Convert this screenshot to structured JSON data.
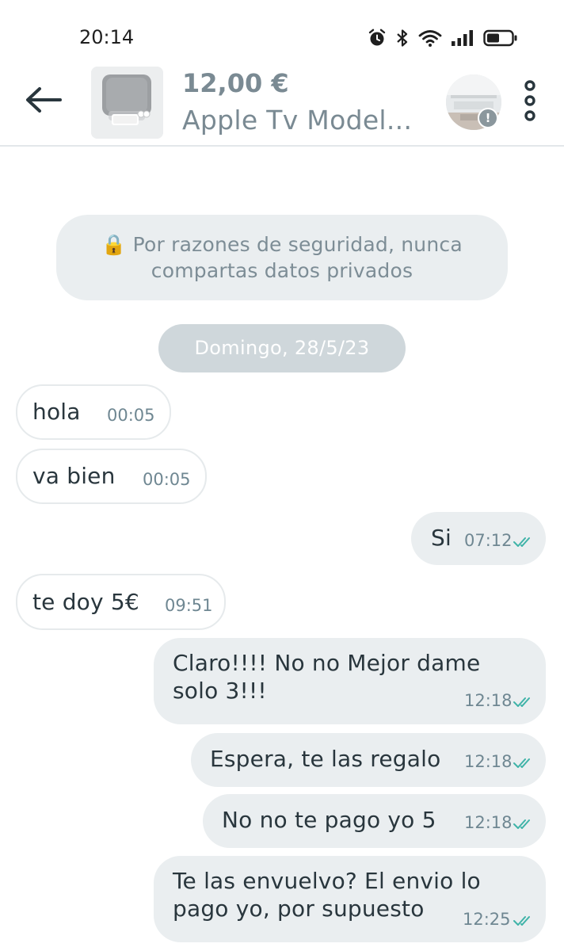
{
  "status_bar": {
    "time": "20:14",
    "icons": [
      "alarm-icon",
      "bluetooth-icon",
      "wifi-icon",
      "signal-icon",
      "battery-icon"
    ]
  },
  "header": {
    "back_icon": "arrow-left-icon",
    "price": "12,00 €",
    "title": "Apple Tv  Model...",
    "more_icon": "vertical-dots-icon",
    "avatar_badge": "!"
  },
  "chat": {
    "security_notice": {
      "icon": "🔒",
      "line1": "Por razones de seguridad, nunca",
      "line2": "compartas datos privados"
    },
    "date_separator": "Domingo, 28/5/23",
    "messages": [
      {
        "direction": "in",
        "lines": [
          "hola"
        ],
        "time": "00:05"
      },
      {
        "direction": "in",
        "lines": [
          "va bien"
        ],
        "time": "00:05"
      },
      {
        "direction": "out",
        "lines": [
          "Si"
        ],
        "time": "07:12",
        "status": "read"
      },
      {
        "direction": "in",
        "lines": [
          "te doy 5€"
        ],
        "time": "09:51"
      },
      {
        "direction": "out",
        "lines": [
          "Claro!!!! No no Mejor dame",
          "solo 3!!!"
        ],
        "time": "12:18",
        "status": "read"
      },
      {
        "direction": "out",
        "lines": [
          "Espera, te las regalo"
        ],
        "time": "12:18",
        "status": "read"
      },
      {
        "direction": "out",
        "lines": [
          "No no te pago yo 5"
        ],
        "time": "12:18",
        "status": "read"
      },
      {
        "direction": "out",
        "lines": [
          "Te las envuelvo? El envio lo",
          "pago yo, por supuesto"
        ],
        "time": "12:25",
        "status": "read"
      }
    ]
  },
  "colors": {
    "incoming_bg": "#ffffff",
    "outgoing_bg": "#eaeef0",
    "read_tick": "#3fb3a8",
    "muted_text": "#7a8a93"
  }
}
